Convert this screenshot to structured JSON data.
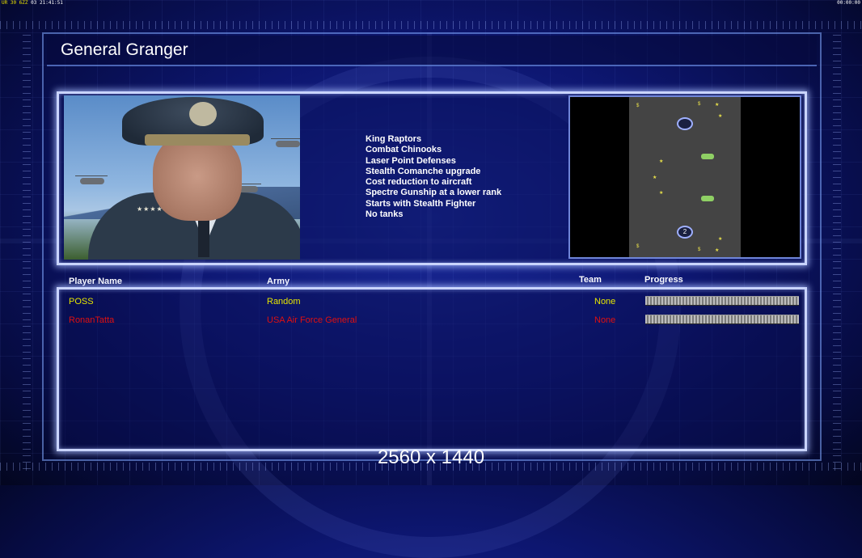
{
  "status_bar": {
    "left_yellow": "UR 30 6ZZ",
    "left_gray": "03",
    "left_time": "21:41:51",
    "right_time": "00:00:00"
  },
  "general_name": "General Granger",
  "features": [
    "King Raptors",
    "Combat Chinooks",
    "Laser Point Defenses",
    "Stealth Comanche upgrade",
    "Cost reduction to aircraft",
    "Spectre Gunship at a lower rank",
    "Starts with Stealth Fighter",
    "No tanks"
  ],
  "map": {
    "start_positions": [
      "",
      "2"
    ]
  },
  "table": {
    "headers": {
      "player_name": "Player Name",
      "army": "Army",
      "team": "Team",
      "progress": "Progress"
    },
    "rows": [
      {
        "player": "POSS",
        "army": "Random",
        "team": "None",
        "progress": 1.0,
        "color": "#e6e600"
      },
      {
        "player": "RonanTatta",
        "army": "USA Air Force General",
        "team": "None",
        "progress": 1.0,
        "color": "#e01010"
      }
    ]
  },
  "resolution_label": "2560 x 1440",
  "colors": {
    "accent_frame": "#c9d4ff",
    "background": "#0d1670",
    "feature_text": "#ffffff"
  }
}
